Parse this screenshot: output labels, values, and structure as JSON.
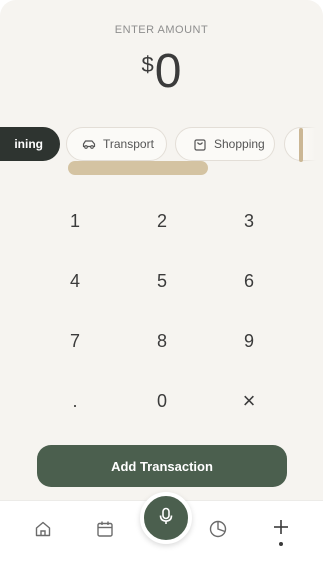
{
  "header": {
    "enter_label": "ENTER AMOUNT",
    "currency": "$",
    "amount": "0"
  },
  "categories": [
    {
      "label": "ining",
      "icon": "dining-icon",
      "active": true
    },
    {
      "label": "Transport",
      "icon": "car-icon",
      "active": false
    },
    {
      "label": "Shopping",
      "icon": "shopping-bag-icon",
      "active": false
    }
  ],
  "keypad": {
    "keys": [
      "1",
      "2",
      "3",
      "4",
      "5",
      "6",
      "7",
      "8",
      "9",
      ".",
      "0",
      "×"
    ]
  },
  "add_button": {
    "label": "Add Transaction"
  },
  "nav": {
    "items": [
      "home-icon",
      "calendar-icon",
      "mic-icon",
      "pie-chart-icon",
      "plus-icon"
    ]
  },
  "colors": {
    "accent": "#4b5f4e",
    "chip_active": "#2e3430",
    "scroll": "#d4c3a2",
    "background": "#f6f4f0"
  }
}
